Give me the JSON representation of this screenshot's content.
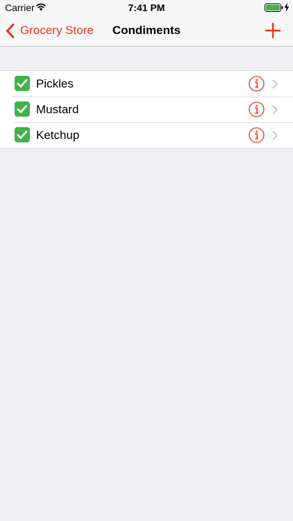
{
  "status_bar": {
    "carrier": "Carrier",
    "time": "7:41 PM",
    "icons": [
      "wifi-icon",
      "battery-icon",
      "charging-bolt-icon"
    ]
  },
  "nav": {
    "back_label": "Grocery Store",
    "title": "Condiments",
    "add_icon": "plus-icon"
  },
  "items": [
    {
      "label": "Pickles",
      "checked": true
    },
    {
      "label": "Mustard",
      "checked": true
    },
    {
      "label": "Ketchup",
      "checked": true
    }
  ],
  "colors": {
    "accent": "#e8341c",
    "check_green": "#3fb349",
    "background": "#efeff4",
    "bar": "#f7f7f7"
  }
}
